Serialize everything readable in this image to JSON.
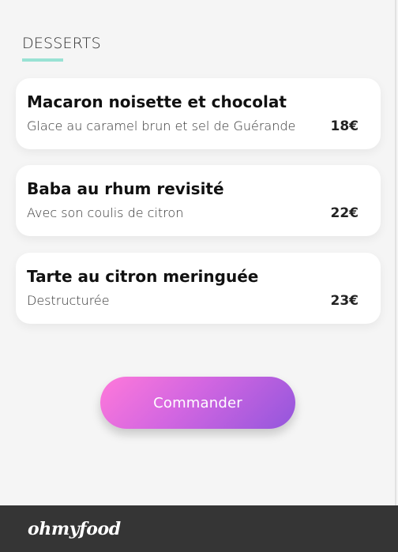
{
  "section": {
    "title": "DESSERTS"
  },
  "menu_items": [
    {
      "title": "Macaron noisette et chocolat",
      "description": "Glace au caramel brun et sel de Guérande",
      "price": "18€"
    },
    {
      "title": "Baba au rhum revisité",
      "description": "Avec son coulis de citron",
      "price": "22€"
    },
    {
      "title": "Tarte au citron meringuée",
      "description": "Destructurée",
      "price": "23€"
    }
  ],
  "actions": {
    "order_label": "Commander"
  },
  "footer": {
    "brand": "ohmyfood"
  },
  "colors": {
    "accent_underline": "#99e2d4",
    "button_gradient_start": "#ff79da",
    "button_gradient_end": "#9356dc",
    "footer_bg": "#353535",
    "page_bg": "#f5f5f5"
  }
}
